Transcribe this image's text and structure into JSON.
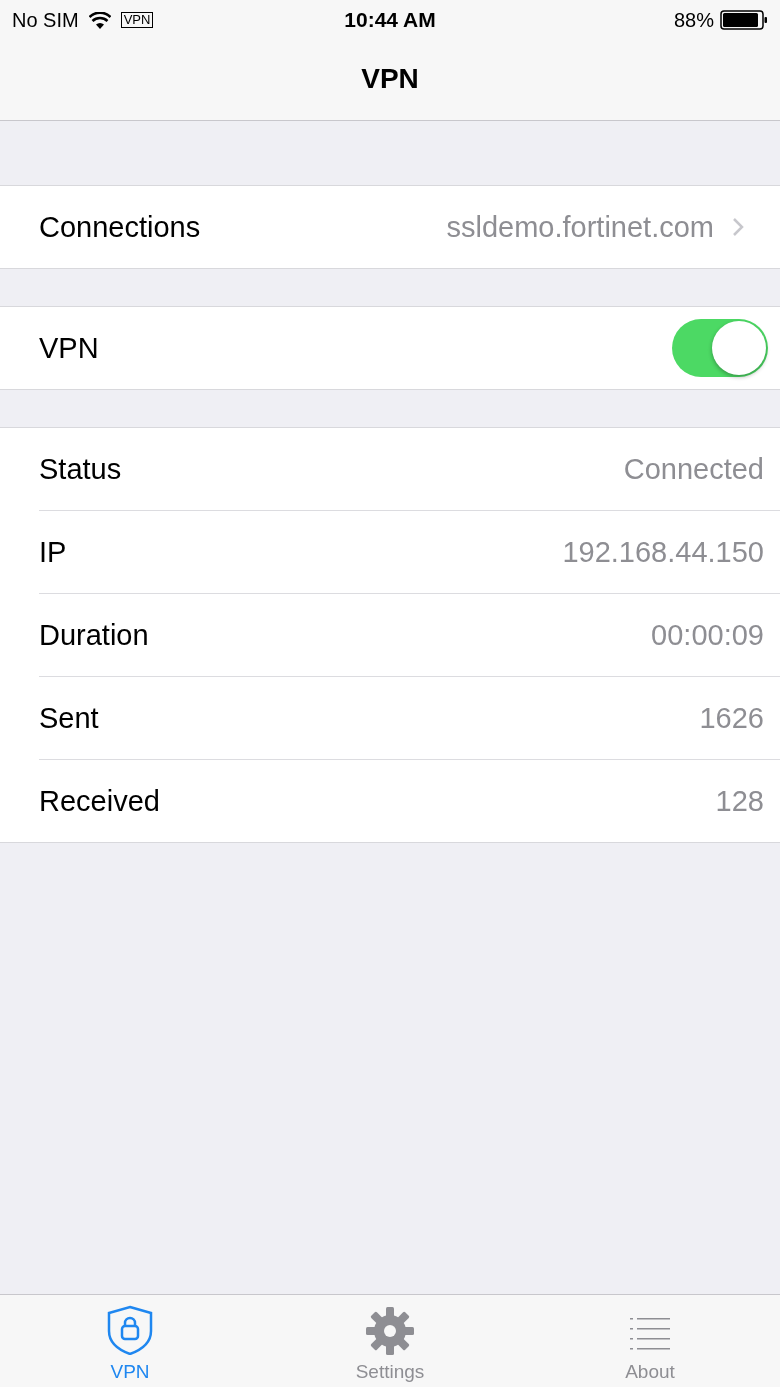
{
  "status_bar": {
    "carrier": "No SIM",
    "vpn_badge": "VPN",
    "time": "10:44 AM",
    "battery": "88%"
  },
  "nav_bar": {
    "title": "VPN"
  },
  "connection": {
    "label": "Connections",
    "value": "ssldemo.fortinet.com"
  },
  "vpn_switch": {
    "label": "VPN",
    "on": true
  },
  "details": [
    {
      "label": "Status",
      "value": "Connected"
    },
    {
      "label": "IP",
      "value": "192.168.44.150"
    },
    {
      "label": "Duration",
      "value": "00:00:09"
    },
    {
      "label": "Sent",
      "value": "1626"
    },
    {
      "label": "Received",
      "value": "128"
    }
  ],
  "tabs": [
    {
      "kind": "shield",
      "label": "VPN",
      "selected": true
    },
    {
      "kind": "gear",
      "label": "Settings",
      "selected": false
    },
    {
      "kind": "list",
      "label": "About",
      "selected": false
    }
  ]
}
